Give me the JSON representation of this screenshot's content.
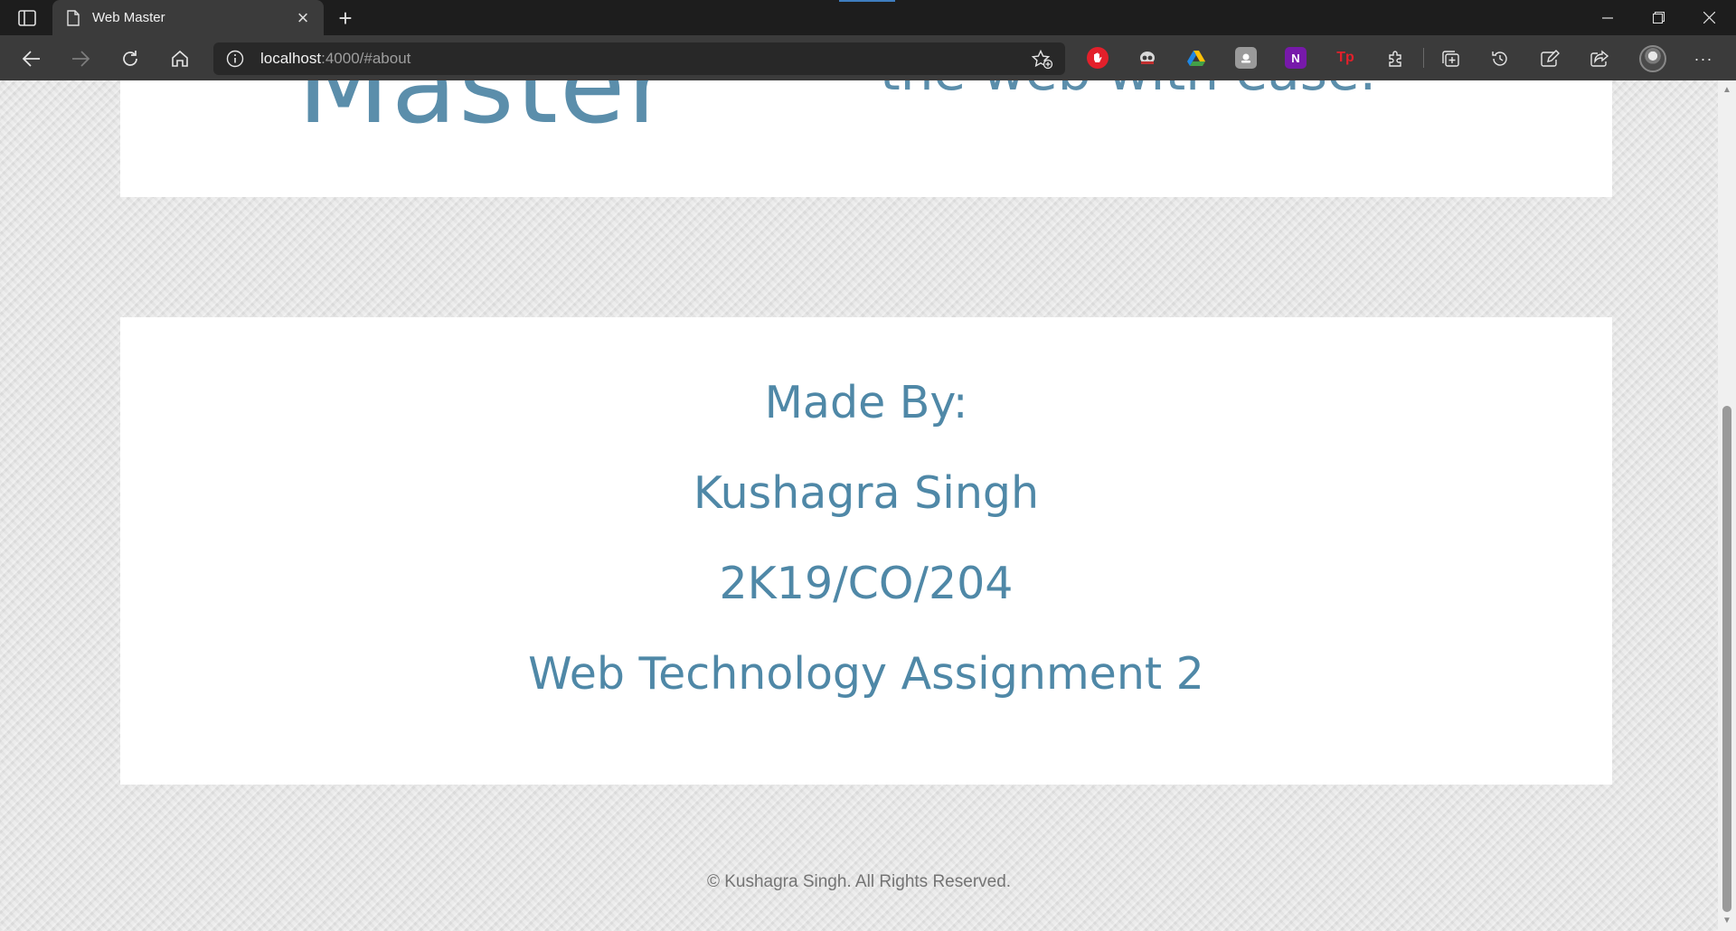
{
  "browser": {
    "tab_title": "Web Master",
    "new_tab_label": "+",
    "tab_close_label": "×",
    "url_host": "localhost",
    "url_rest": ":4000/#about",
    "extensions": [
      {
        "name": "adblock",
        "color": "#e3202b",
        "glyph": "✋"
      },
      {
        "name": "ghostery",
        "color": "#3b3b3b",
        "glyph": "◉"
      },
      {
        "name": "google-drive",
        "color": "#3b3b3b",
        "glyph": "▲"
      },
      {
        "name": "capture",
        "color": "#8c8c8c",
        "glyph": "▪"
      },
      {
        "name": "onenote",
        "color": "#7719aa",
        "glyph": "N"
      },
      {
        "name": "textpad",
        "color": "#3b3b3b",
        "glyph": "Tp"
      }
    ]
  },
  "page": {
    "hero_title": "Master",
    "hero_subtitle": "the web with ease."
  },
  "about": {
    "made_by_label": "Made By:",
    "author_name": "Kushagra Singh",
    "roll_number": "2K19/CO/204",
    "assignment": "Web Technology Assignment 2"
  },
  "footer": {
    "text": "© Kushagra Singh. All Rights Reserved."
  },
  "colors": {
    "accent": "#4f88a7",
    "footer_text": "#747474"
  }
}
